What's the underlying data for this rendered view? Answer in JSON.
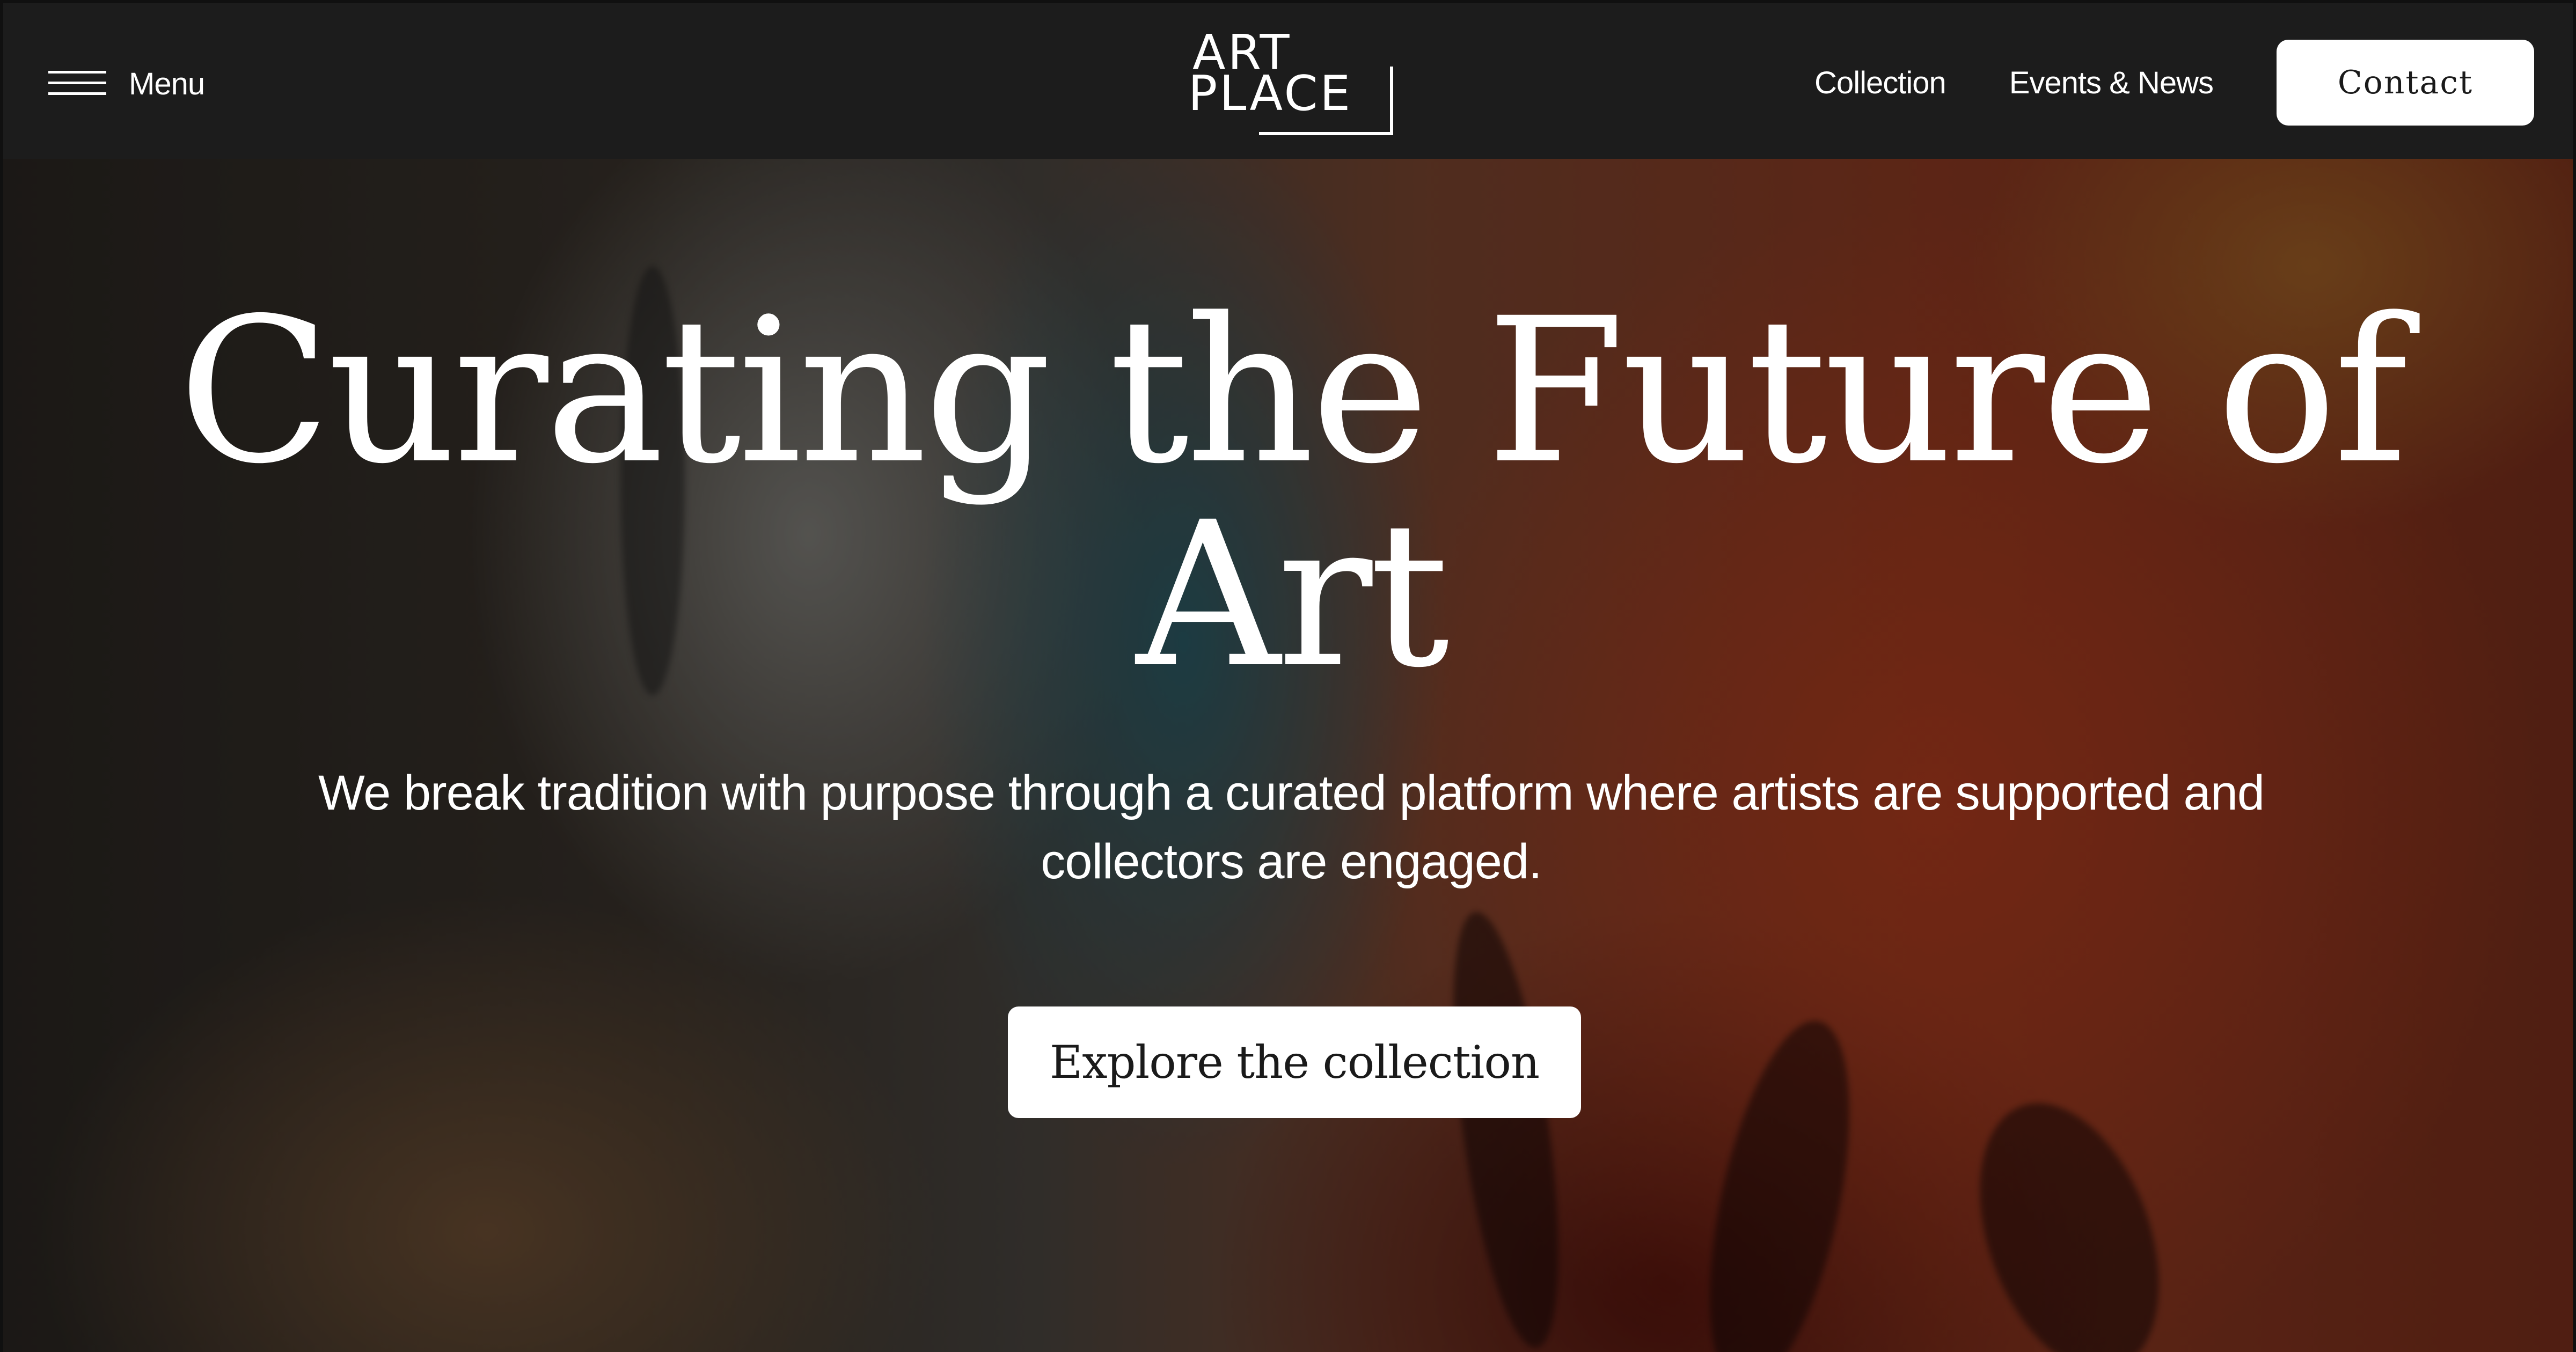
{
  "header": {
    "menu_label": "Menu",
    "logo_line1": "ART",
    "logo_line2": "PLACE",
    "nav": [
      {
        "label": "Collection"
      },
      {
        "label": "Events & News"
      }
    ],
    "contact_label": "Contact"
  },
  "hero": {
    "title": "Curating the Future of Art",
    "subtitle": "We break tradition with purpose through a curated platform where artists are supported and collectors are engaged.",
    "cta_label": "Explore the collection"
  },
  "colors": {
    "nav_background": "#1c1c1c",
    "button_background": "#ffffff",
    "text_light": "#ffffff",
    "text_dark": "#1a1a1a"
  },
  "icons": {
    "menu": "hamburger-icon"
  }
}
